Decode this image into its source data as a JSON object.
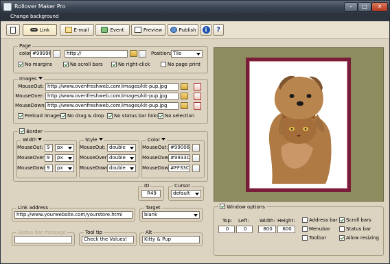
{
  "window": {
    "title": "Rollover Maker Pro",
    "min_icon": "minimize-icon",
    "max_icon": "maximize-icon",
    "close_icon": "close-icon"
  },
  "menu": {
    "change_background": "Change background"
  },
  "toolbar": {
    "link": "Link",
    "email": "E-mail",
    "event": "Event",
    "preview": "Preview",
    "publish": "Publish",
    "info": "i",
    "help": "?"
  },
  "page": {
    "legend": "Page",
    "color_label": "color:",
    "color_value": "#999966",
    "url_value": "http://",
    "position_label": "Position:",
    "position_value": "Tile",
    "no_margins": "No margins",
    "no_scroll_bars": "No scroll bars",
    "no_right_click": "No right-click",
    "no_page_print": "No page print"
  },
  "images": {
    "legend": "Images",
    "mouseout_label": "MouseOut:",
    "mouseout_value": "http://www.ovenfreshweb.com/images/kit-pup.jpg",
    "mouseover_label": "MouseOver:",
    "mouseover_value": "http://www.ovenfreshweb.com/images/kit-pup.jpg",
    "mousedown_label": "MouseDown:",
    "mousedown_value": "http://www.ovenfreshweb.com/images/kit-pup.jpg",
    "preload": "Preload images",
    "no_drag": "No drag & drop",
    "no_status": "No status bar links",
    "no_selection": "No selection"
  },
  "border": {
    "legend": "Border",
    "width": {
      "legend": "Width",
      "out_label": "MouseOut:",
      "out_value": "9",
      "out_unit": "px",
      "over_label": "MouseOver:",
      "over_value": "9",
      "over_unit": "px",
      "down_label": "MouseDown:",
      "down_value": "9",
      "down_unit": "px"
    },
    "style": {
      "legend": "Style",
      "out_label": "MouseOut:",
      "out_value": "double",
      "over_label": "MouseOver:",
      "over_value": "double",
      "down_label": "MouseDown:",
      "down_value": "double"
    },
    "color": {
      "legend": "Color",
      "out_label": "MouseOut:",
      "out_value": "#990066",
      "over_label": "MouseOver:",
      "over_value": "#9933CC",
      "down_label": "MouseDown:",
      "down_value": "#FF33CC"
    }
  },
  "id_field": {
    "legend": "ID",
    "value": "R49"
  },
  "cursor": {
    "legend": "Cursor",
    "value": "default"
  },
  "link_address": {
    "legend": "Link address",
    "value": "http://www.yourwebsite.com/yourstore.html"
  },
  "target": {
    "legend": "Target",
    "value": "blank"
  },
  "status_bar_message": {
    "legend": "Status bar message",
    "value": ""
  },
  "tooltip": {
    "legend": "Tool tip",
    "value": "Check the Values!"
  },
  "alt": {
    "legend": "Alt",
    "value": "Kitty & Pup"
  },
  "window_options": {
    "legend": "Window options",
    "top_label": "Top:",
    "top_value": "0",
    "left_label": "Left:",
    "left_value": "0",
    "width_label": "Width:",
    "width_value": "800",
    "height_label": "Height:",
    "height_value": "600",
    "address_bar": "Address bar",
    "menubar": "Menubar",
    "toolbar": "Toolbar",
    "scroll_bars": "Scroll bars",
    "status_bar": "Status bar",
    "allow_resizing": "Allow resizing"
  },
  "colors": {
    "frame": "#7a1d3a",
    "preview_bg": "#8d8c5f",
    "chrome": "#ddd3c1"
  }
}
